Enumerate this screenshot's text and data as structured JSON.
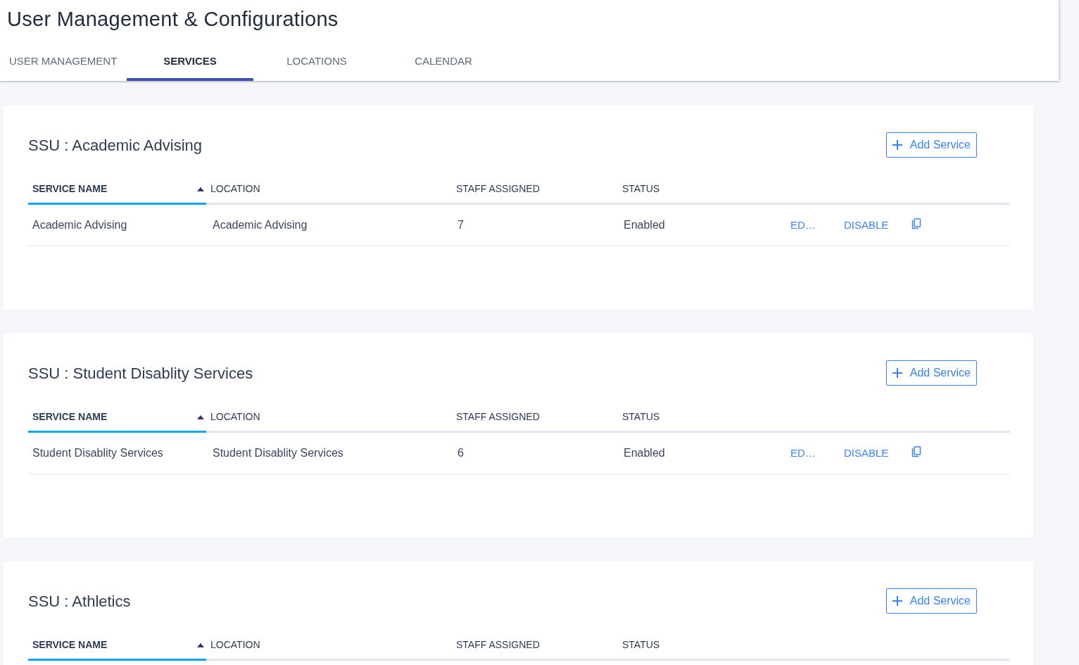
{
  "page_title": "User Management & Configurations",
  "tabs": [
    {
      "label": "USER MANAGEMENT",
      "selected": false
    },
    {
      "label": "SERVICES",
      "selected": true
    },
    {
      "label": "LOCATIONS",
      "selected": false
    },
    {
      "label": "CALENDAR",
      "selected": false
    }
  ],
  "sections": [
    {
      "title": "SSU : Academic Advising",
      "add_button": "Add Service",
      "columns": [
        {
          "label": "SERVICE NAME",
          "sorted": true
        },
        {
          "label": "LOCATION",
          "sorted": false
        },
        {
          "label": "STAFF ASSIGNED",
          "sorted": false
        },
        {
          "label": "STATUS",
          "sorted": false
        }
      ],
      "rows": [
        {
          "service_name": "Academic Advising",
          "location": "Academic Advising",
          "staff_assigned": "7",
          "status": "Enabled",
          "edit": "ED…",
          "disable": "DISABLE"
        }
      ]
    },
    {
      "title": "SSU : Student Disablity Services",
      "add_button": "Add Service",
      "columns": [
        {
          "label": "SERVICE NAME",
          "sorted": true
        },
        {
          "label": "LOCATION",
          "sorted": false
        },
        {
          "label": "STAFF ASSIGNED",
          "sorted": false
        },
        {
          "label": "STATUS",
          "sorted": false
        }
      ],
      "rows": [
        {
          "service_name": "Student Disablity Services",
          "location": "Student Disablity Services",
          "staff_assigned": "6",
          "status": "Enabled",
          "edit": "ED…",
          "disable": "DISABLE"
        }
      ]
    },
    {
      "title": "SSU : Athletics",
      "add_button": "Add Service",
      "columns": [
        {
          "label": "SERVICE NAME",
          "sorted": true
        },
        {
          "label": "LOCATION",
          "sorted": false
        },
        {
          "label": "STAFF ASSIGNED",
          "sorted": false
        },
        {
          "label": "STATUS",
          "sorted": false
        }
      ]
    }
  ]
}
